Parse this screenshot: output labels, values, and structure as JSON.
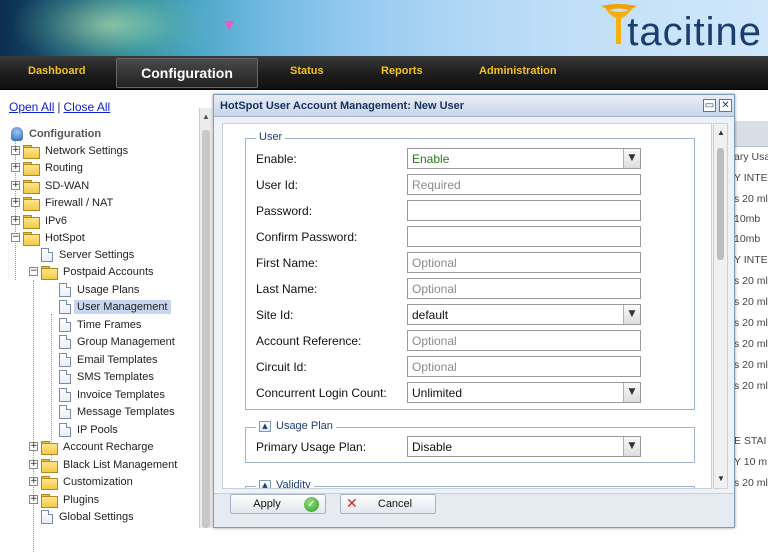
{
  "brand": {
    "name": "tacitine"
  },
  "topnav": {
    "items": [
      {
        "label": "Dashboard"
      },
      {
        "label": "Configuration"
      },
      {
        "label": "Status"
      },
      {
        "label": "Reports"
      },
      {
        "label": "Administration"
      }
    ]
  },
  "sidebar": {
    "open_all": "Open All",
    "separator": "|",
    "close_all": "Close All",
    "root": "Configuration",
    "items": [
      {
        "label": "Network Settings"
      },
      {
        "label": "Routing"
      },
      {
        "label": "SD-WAN"
      },
      {
        "label": "Firewall / NAT"
      },
      {
        "label": "IPv6"
      },
      {
        "label": "HotSpot"
      },
      {
        "label": "Server Settings"
      },
      {
        "label": "Postpaid Accounts"
      },
      {
        "label": "Usage Plans"
      },
      {
        "label": "User Management"
      },
      {
        "label": "Time Frames"
      },
      {
        "label": "Group Management"
      },
      {
        "label": "Email Templates"
      },
      {
        "label": "SMS Templates"
      },
      {
        "label": "Invoice Templates"
      },
      {
        "label": "Message Templates"
      },
      {
        "label": "IP Pools"
      },
      {
        "label": "Account Recharge"
      },
      {
        "label": "Black List Management"
      },
      {
        "label": "Customization"
      },
      {
        "label": "Plugins"
      },
      {
        "label": "Global Settings"
      }
    ]
  },
  "background_table": {
    "header": "ary Usa",
    "cells": [
      "Y INTE",
      "s 20 ml",
      "10mb",
      "10mb",
      "Y INTE",
      "s 20 ml",
      "s 20 ml",
      "s 20 ml",
      "s 20 ml",
      "s 20 ml",
      "s 20 ml",
      "E STAI",
      "Y 10 m",
      "s 20 ml"
    ]
  },
  "dialog": {
    "title": "HotSpot User Account Management: New User",
    "restore_glyph": "▭",
    "close_glyph": "✕",
    "user_group": {
      "legend": "User",
      "fields": [
        {
          "label": "Enable:",
          "value": "Enable"
        },
        {
          "label": "User Id:",
          "placeholder": "Required"
        },
        {
          "label": "Password:",
          "value": ""
        },
        {
          "label": "Confirm Password:",
          "value": ""
        },
        {
          "label": "First Name:",
          "placeholder": "Optional"
        },
        {
          "label": "Last Name:",
          "placeholder": "Optional"
        },
        {
          "label": "Site Id:",
          "value": "default"
        },
        {
          "label": "Account Reference:",
          "placeholder": "Optional"
        },
        {
          "label": "Circuit Id:",
          "placeholder": "Optional"
        },
        {
          "label": "Concurrent Login Count:",
          "value": "Unlimited"
        }
      ]
    },
    "usage_group": {
      "legend": "Usage Plan",
      "field": {
        "label": "Primary Usage Plan:",
        "value": "Disable"
      }
    },
    "validity_group": {
      "legend": "Validity"
    },
    "apply_label": "Apply",
    "cancel_label": "Cancel"
  },
  "colors": {
    "nav_text": "#f3c21c",
    "enable_text": "#2a7a1c",
    "dialog_title": "#15315d",
    "link": "#1020d0"
  }
}
